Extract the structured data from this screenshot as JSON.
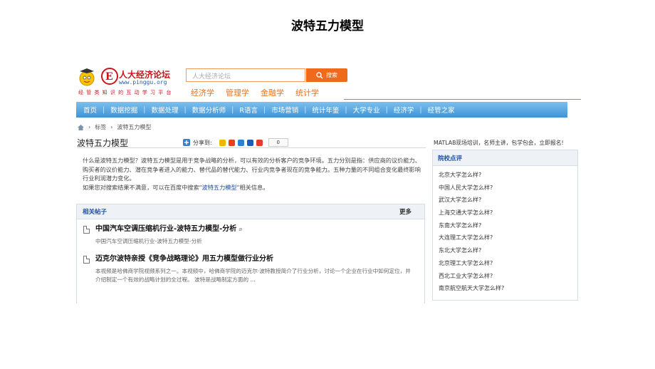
{
  "slide_title": "波特五力模型",
  "site": {
    "name": "人大经济论坛",
    "url": "www.pinggu.org",
    "slogan": "经 管 类 知 识 的 互 动 学 习 平 台"
  },
  "search": {
    "placeholder": "人大经济论坛",
    "button_label": "搜索"
  },
  "sub_links": [
    "经济学",
    "管理学",
    "金融学",
    "统计学"
  ],
  "nav": [
    "首页",
    "数据挖掘",
    "数据处理",
    "数据分析师",
    "R语言",
    "市场营销",
    "统计年鉴",
    "大学专业",
    "经济学",
    "经管之家"
  ],
  "breadcrumb": {
    "tag": "标签",
    "current": "波特五力模型"
  },
  "page_heading": "波特五力模型",
  "share": {
    "label": "分享到:",
    "count": "0",
    "colors": [
      "#f5b400",
      "#e2421f",
      "#2f7fd4",
      "#1d5fb8",
      "#e63b2e"
    ]
  },
  "description": {
    "text": "什么是波特五力模型？波特五力模型是用于竞争战略的分析，可以有效的分析客户的竞争环境。五力分别是指：供应商的议价能力、购买者的议价能力、潜在竞争者进入的能力、替代品的替代能力、行业内竞争者现在的竞争能力。五种力量的不同组合变化最终影响行业利润潜力变化。",
    "more_prefix": "如果您对搜索结果不满意，可以在百度中搜索\"",
    "more_link": "波特五力模型",
    "more_suffix": "\"相关信息。"
  },
  "related": {
    "header": "相关帖子",
    "more": "更多",
    "posts": [
      {
        "title": "中国汽车空调压缩机行业-波特五力模型-分析",
        "meta": "中国汽车空调压缩机行业-波特五力模型-分析"
      },
      {
        "title": "迈克尔波特亲授《竞争战略理论》用五力模型做行业分析",
        "meta": "本视频是哈佛商学院视频系列之一。本视频中，哈佛商学院的迈克尔·波特教授简介了行业分析，讨论一个企业在行业中如何定位，并介绍制定一个有效的战略计划的全过程。 波特是战略制定方面的 ..."
      }
    ]
  },
  "sidebar": {
    "promo": "MATLAB现场培训，名师主讲，包学包会，立即报名!",
    "header": "院校点评",
    "items": [
      "北京大学怎么样?",
      "中国人民大学怎么样?",
      "武汉大学怎么样?",
      "上海交通大学怎么样?",
      "东南大学怎么样?",
      "大连理工大学怎么样?",
      "东北大学怎么样?",
      "北京理工大学怎么样?",
      "西北工业大学怎么样?",
      "南京航空航天大学怎么样?"
    ]
  }
}
